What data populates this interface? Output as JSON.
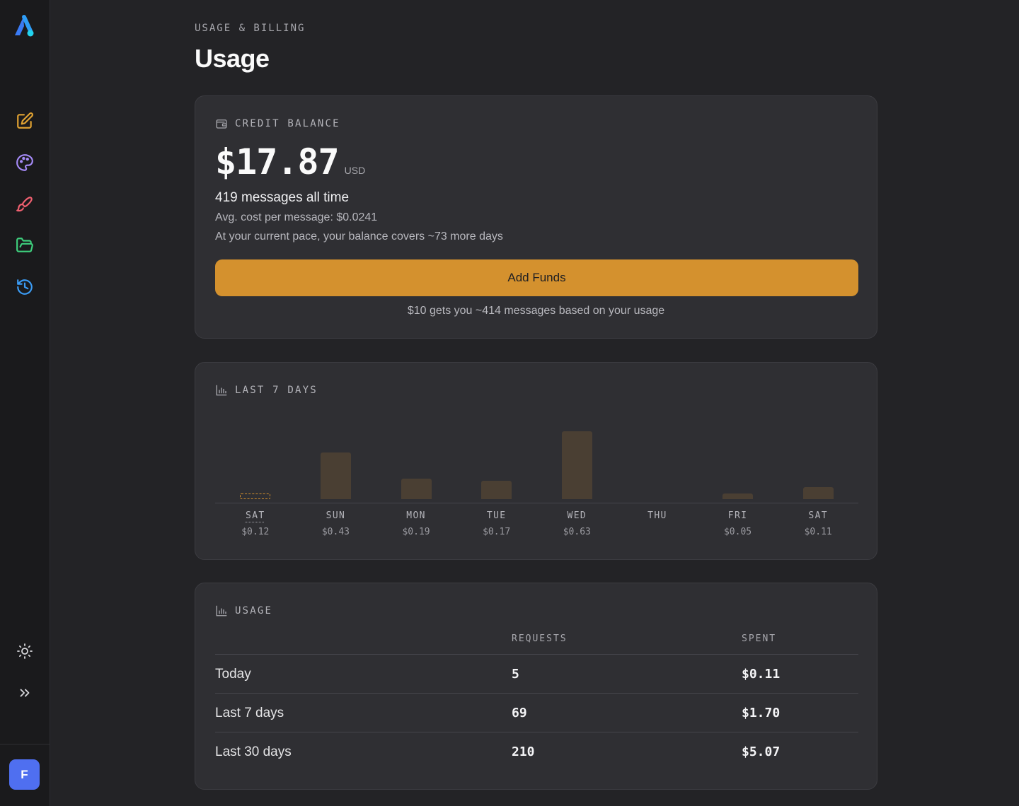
{
  "sidebar": {
    "nav": [
      {
        "icon": "pencil-square-icon",
        "color": "#e0a232"
      },
      {
        "icon": "palette-icon",
        "color": "#a58af7"
      },
      {
        "icon": "brush-icon",
        "color": "#f06070"
      },
      {
        "icon": "folder-open-icon",
        "color": "#3ecf7d"
      },
      {
        "icon": "history-icon",
        "color": "#3b9cf5"
      }
    ],
    "theme_icon": "sun-icon",
    "expand_icon": "chevrons-right-icon",
    "avatar_initial": "F",
    "avatar_color": "#4f6ff0"
  },
  "header": {
    "eyebrow": "USAGE & BILLING",
    "title": "Usage"
  },
  "credit": {
    "label": "CREDIT BALANCE",
    "icon": "wallet-icon",
    "amount": "$17.87",
    "currency": "USD",
    "messages_total": "419 messages all time",
    "avg_cost": "Avg. cost per message: $0.0241",
    "pace": "At your current pace, your balance covers ~73 more days",
    "add_funds_label": "Add Funds",
    "funds_hint": "$10 gets you ~414 messages based on your usage",
    "accent": "#d4912e"
  },
  "last7": {
    "label": "LAST 7 DAYS",
    "icon": "bar-chart-icon"
  },
  "chart_data": {
    "type": "bar",
    "title": "LAST 7 DAYS",
    "categories": [
      "SAT",
      "SUN",
      "MON",
      "TUE",
      "WED",
      "THU",
      "FRI",
      "SAT"
    ],
    "values": [
      0.12,
      0.43,
      0.19,
      0.17,
      0.63,
      0,
      0.05,
      0.11
    ],
    "value_labels": [
      "$0.12",
      "$0.43",
      "$0.19",
      "$0.17",
      "$0.63",
      "",
      "$0.05",
      "$0.11"
    ],
    "highlight_index": 0,
    "ylim": [
      0,
      0.63
    ],
    "grid": false,
    "legend": "none"
  },
  "usage": {
    "label": "USAGE",
    "icon": "bar-chart-icon",
    "columns": [
      "REQUESTS",
      "SPENT"
    ],
    "rows": [
      {
        "label": "Today",
        "requests": "5",
        "spent": "$0.11"
      },
      {
        "label": "Last 7 days",
        "requests": "69",
        "spent": "$1.70"
      },
      {
        "label": "Last 30 days",
        "requests": "210",
        "spent": "$5.07"
      }
    ]
  }
}
